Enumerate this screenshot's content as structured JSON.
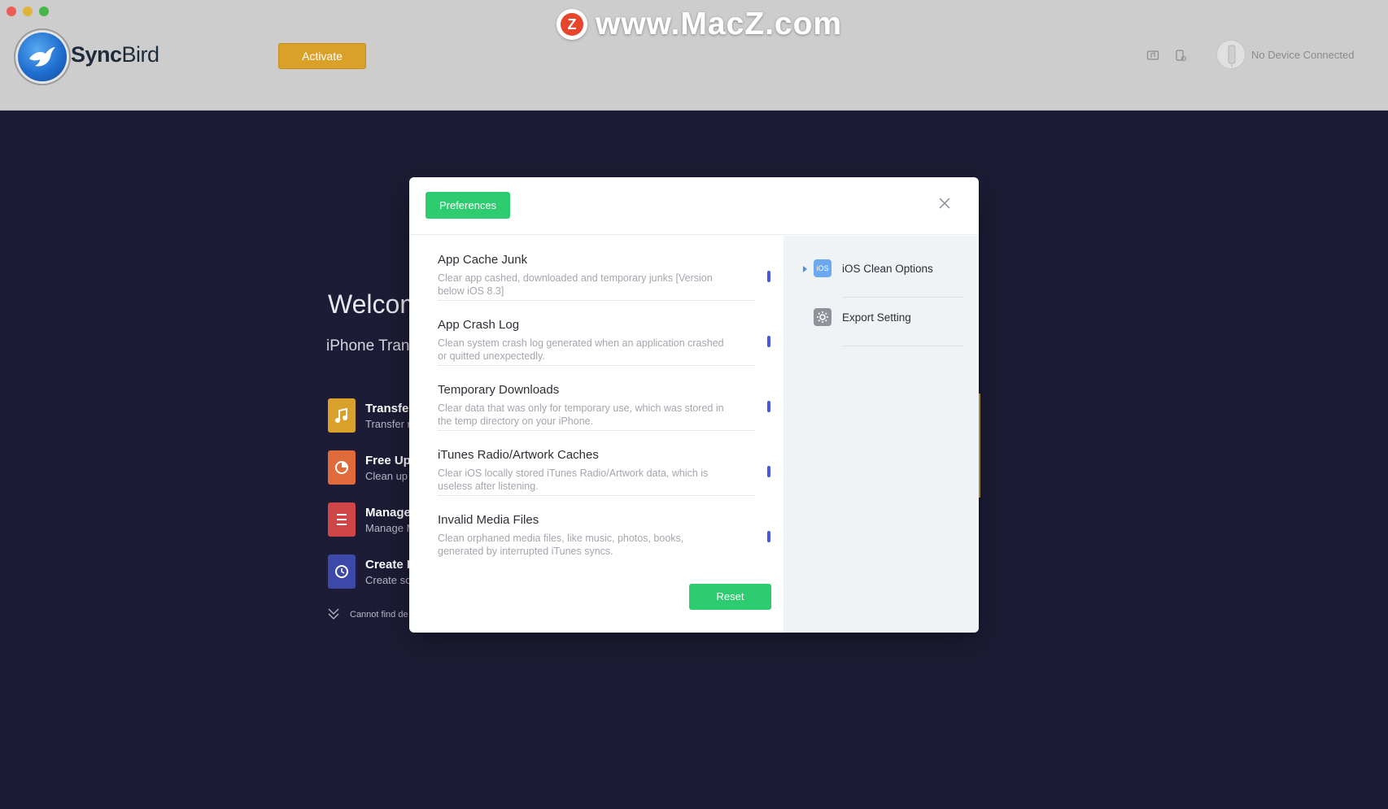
{
  "app": {
    "brand_bold": "Sync",
    "brand_light": "Bird",
    "activate_label": "Activate",
    "device_status": "No Device Connected",
    "watermark_badge": "Z",
    "watermark_text": "www.MacZ.com"
  },
  "welcome": {
    "title": "Welcom",
    "subtitle": "iPhone Trans",
    "features": [
      {
        "title": "Transfer",
        "subtitle": "Transfer n",
        "icon": "music-note-icon",
        "color": "#d9a12a"
      },
      {
        "title": "Free Up",
        "subtitle": "Clean up",
        "icon": "pie-chart-icon",
        "color": "#e06a3a"
      },
      {
        "title": "Manage",
        "subtitle": "Manage M",
        "icon": "list-icon",
        "color": "#d04545"
      },
      {
        "title": "Create B",
        "subtitle": "Create so",
        "icon": "clock-icon",
        "color": "#3c49a8"
      }
    ],
    "cannot_find": "Cannot find de"
  },
  "modal": {
    "preferences_label": "Preferences",
    "reset_label": "Reset",
    "items": [
      {
        "title": "App Cache Junk",
        "desc": "Clear app cashed, downloaded and temporary junks [Version below iOS 8.3]"
      },
      {
        "title": "App Crash Log",
        "desc": "Clean system crash log generated when an application crashed or quitted unexpectedly."
      },
      {
        "title": "Temporary Downloads",
        "desc": "Clear data that was only for temporary use, which was stored in the temp directory on your iPhone."
      },
      {
        "title": "iTunes Radio/Artwork Caches",
        "desc": "Clear iOS locally stored iTunes Radio/Artwork data, which is useless after listening."
      },
      {
        "title": "Invalid Media Files",
        "desc": "Clean orphaned media files, like music, photos, books, generated by interrupted iTunes syncs."
      }
    ],
    "side": [
      {
        "label": "iOS Clean Options",
        "icon_text": "iOS",
        "icon": "ios-icon"
      },
      {
        "label": "Export Setting",
        "icon": "gear-icon"
      }
    ]
  },
  "colors": {
    "green": "#2ecc71",
    "activate": "#d9a12a",
    "toggle": "#4a56e2",
    "background": "#1c1c36"
  }
}
